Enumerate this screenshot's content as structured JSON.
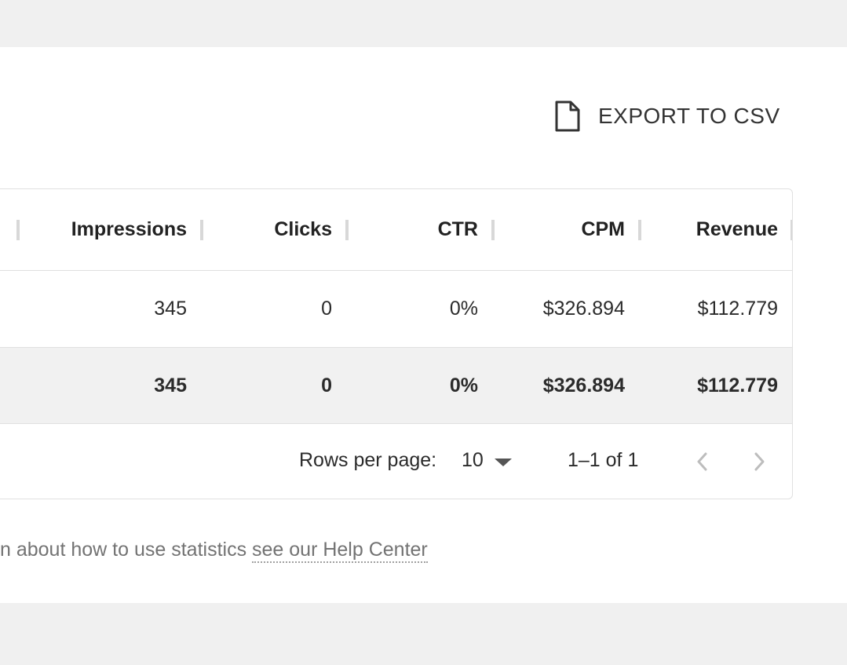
{
  "toolbar": {
    "export_label": "EXPORT TO CSV",
    "export_icon": "file-icon"
  },
  "table": {
    "columns": [
      "Impressions",
      "Clicks",
      "CTR",
      "CPM",
      "Revenue"
    ],
    "row": {
      "impressions": "345",
      "clicks": "0",
      "ctr": "0%",
      "cpm": "$326.894",
      "revenue": "$112.779"
    },
    "total": {
      "impressions": "345",
      "clicks": "0",
      "ctr": "0%",
      "cpm": "$326.894",
      "revenue": "$112.779"
    }
  },
  "pagination": {
    "rows_per_page_label": "Rows per page:",
    "rows_per_page_value": "10",
    "range_text": "1–1 of 1",
    "prev_icon": "chevron-left-icon",
    "next_icon": "chevron-right-icon"
  },
  "help": {
    "text": "n about how to use statistics ",
    "link": "see our Help Center"
  }
}
